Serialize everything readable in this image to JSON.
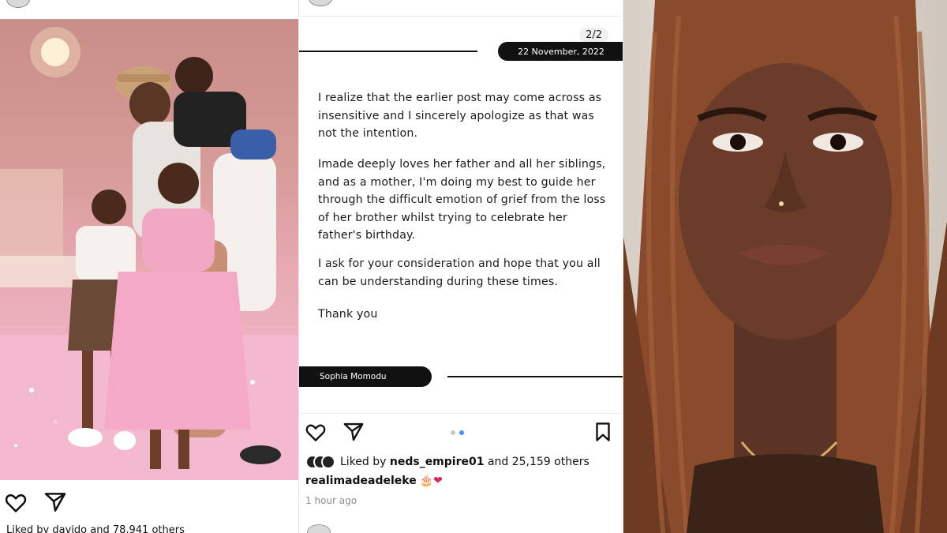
{
  "left_post": {
    "photo_description_icon": "family-photo",
    "likes_text": "Liked by davido and 78,941 others"
  },
  "middle_post": {
    "slide_counter": "2/2",
    "date": "22 November, 2022",
    "paragraphs": [
      "I realize that the earlier post may come across as insensitive and I sincerely apologize as that was not the intention.",
      "Imade deeply loves her father and all her siblings, and as a mother, I'm doing my best to guide her through the difficult emotion of grief from the loss of her brother whilst trying to celebrate her father's birthday.",
      "I ask for your consideration and hope that you all can be understanding during these times.",
      "Thank you"
    ],
    "author": "Sophia Momodu",
    "likes_prefix": "Liked by",
    "likes_user": "neds_empire01",
    "likes_suffix": "and 25,159 others",
    "caption_user": "realimadeadeleke",
    "caption_emoji": "🎂❤",
    "time_ago": "1 hour ago"
  },
  "colors": {
    "pill_bg": "#111111",
    "dot_active": "#3897f0",
    "dot_inactive": "#c7c7c7",
    "time_gray": "#8e8e8e"
  }
}
